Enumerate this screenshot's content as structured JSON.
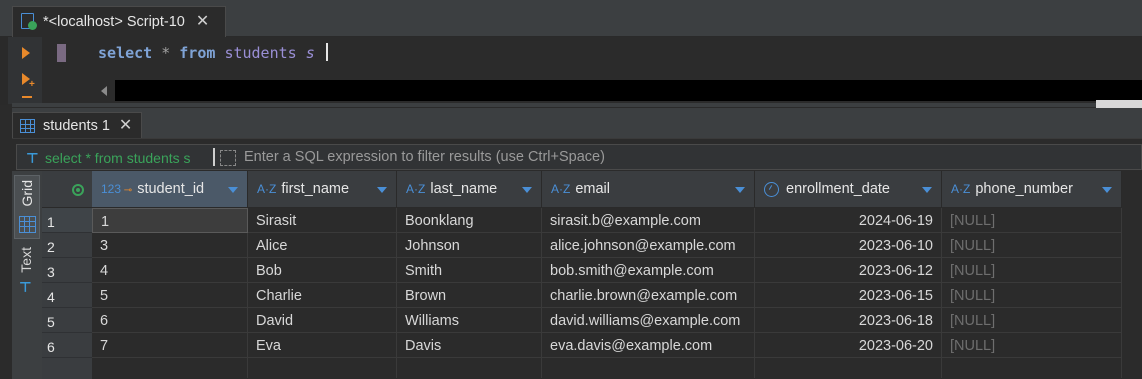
{
  "editor_tab": {
    "title": "*<localhost> Script-10",
    "close": "✕"
  },
  "editor": {
    "kw_select": "select",
    "op_star": "*",
    "kw_from": "from",
    "table": "students",
    "alias": "s"
  },
  "results_tab": {
    "title": "students 1",
    "close": "✕"
  },
  "filter": {
    "query": "select * from students s",
    "placeholder": "Enter a SQL expression to filter results (use Ctrl+Space)"
  },
  "side_panel": {
    "grid_label": "Grid",
    "text_label": "Text"
  },
  "columns": [
    {
      "name": "student_id",
      "type": "123",
      "key": true
    },
    {
      "name": "first_name",
      "type": "A-Z"
    },
    {
      "name": "last_name",
      "type": "A-Z"
    },
    {
      "name": "email",
      "type": "A-Z"
    },
    {
      "name": "enrollment_date",
      "type": "clock"
    },
    {
      "name": "phone_number",
      "type": "A-Z"
    }
  ],
  "rows": [
    {
      "num": "1",
      "student_id": "1",
      "first_name": "Sirasit",
      "last_name": "Boonklang",
      "email": "sirasit.b@example.com",
      "enrollment_date": "2024-06-19",
      "phone_number": "[NULL]"
    },
    {
      "num": "2",
      "student_id": "3",
      "first_name": "Alice",
      "last_name": "Johnson",
      "email": "alice.johnson@example.com",
      "enrollment_date": "2023-06-10",
      "phone_number": "[NULL]"
    },
    {
      "num": "3",
      "student_id": "4",
      "first_name": "Bob",
      "last_name": "Smith",
      "email": "bob.smith@example.com",
      "enrollment_date": "2023-06-12",
      "phone_number": "[NULL]"
    },
    {
      "num": "4",
      "student_id": "5",
      "first_name": "Charlie",
      "last_name": "Brown",
      "email": "charlie.brown@example.com",
      "enrollment_date": "2023-06-15",
      "phone_number": "[NULL]"
    },
    {
      "num": "5",
      "student_id": "6",
      "first_name": "David",
      "last_name": "Williams",
      "email": "david.williams@example.com",
      "enrollment_date": "2023-06-18",
      "phone_number": "[NULL]"
    },
    {
      "num": "6",
      "student_id": "7",
      "first_name": "Eva",
      "last_name": "Davis",
      "email": "eva.davis@example.com",
      "enrollment_date": "2023-06-20",
      "phone_number": "[NULL]"
    }
  ],
  "colors": {
    "accent": "#4a8fd6",
    "ok": "#3aa35a",
    "run": "#e8892b"
  }
}
